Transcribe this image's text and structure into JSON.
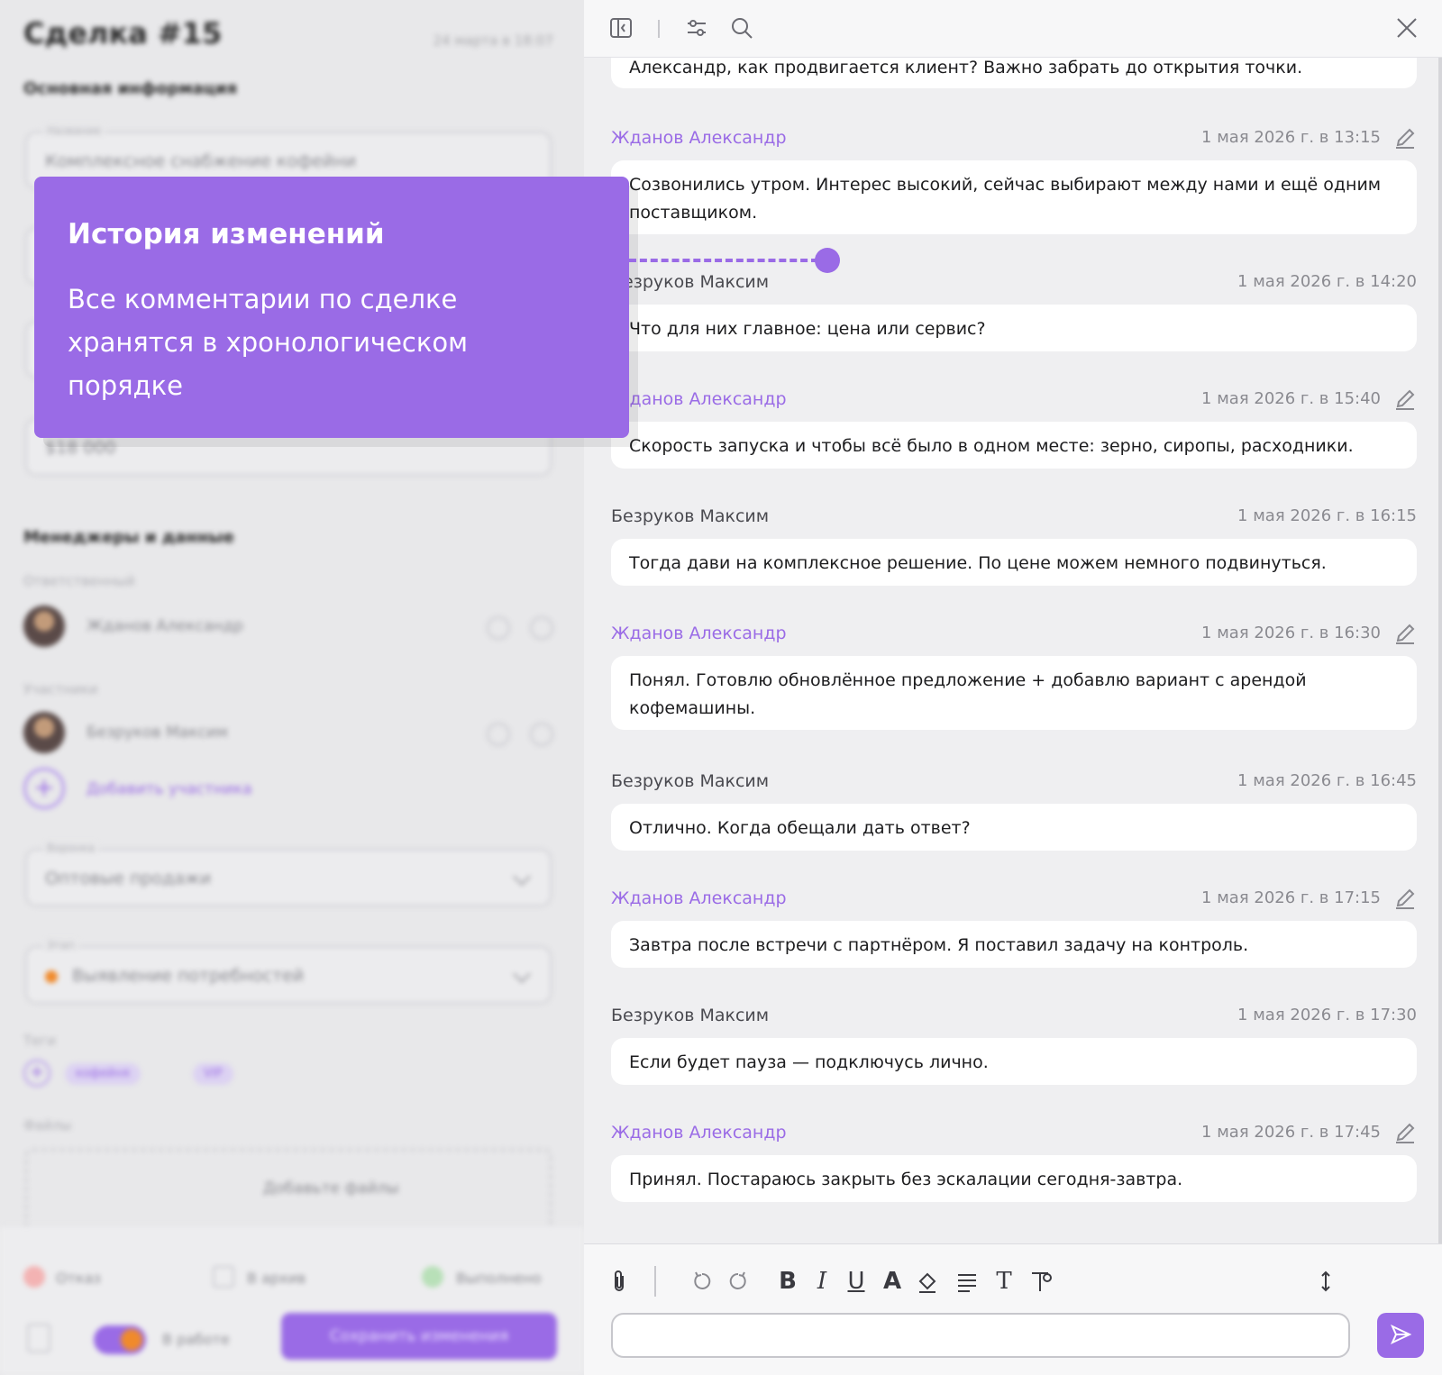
{
  "deal": {
    "title": "Сделка #15",
    "date": "24 марта в 18:07",
    "main_info_heading": "Основная информация",
    "name_label": "Название",
    "name_value": "Комплексное снабжение кофейни",
    "amount_value": "$18 000",
    "managers_heading": "Менеджеры и данные",
    "responsible_label": "Ответственный",
    "responsible_name": "Жданов Александр",
    "participants_label": "Участники",
    "participant_name": "Безруков Максим",
    "add_participant": "Добавить участника",
    "funnel_label": "Воронка",
    "funnel_value": "Оптовые продажи",
    "stage_label": "Этап",
    "stage_value": "Выявление потребностей",
    "tags_label": "Теги",
    "tags": [
      "кофейня",
      "VIP"
    ],
    "files_label": "Файлы",
    "add_files": "Добавьте файлы",
    "footer": {
      "reject": "Отказ",
      "archive": "В архив",
      "done": "Выполнено",
      "toggle_label": "В работе",
      "save_button": "Сохранить изменения"
    }
  },
  "callout": {
    "title": "История изменений",
    "body": "Все комментарии по сделке хранятся в хронологическом порядке"
  },
  "messages": [
    {
      "author": "",
      "date": "",
      "text": "Александр, как продвигается клиент? Важно забрать до открытия точки.",
      "editable": false
    },
    {
      "author": "Жданов Александр",
      "date": "1 мая 2026 г. в 13:15",
      "text": "Созвонились утром. Интерес высокий, сейчас выбирают между нами и ещё одним поставщиком.",
      "editable": true
    },
    {
      "author": "Безруков Максим",
      "date": "1 мая 2026 г. в 14:20",
      "text": "Что для них главное: цена или сервис?",
      "editable": false
    },
    {
      "author": "Жданов Александр",
      "date": "1 мая 2026 г. в 15:40",
      "text": "Скорость запуска и чтобы всё было в одном месте: зерно, сиропы, расходники.",
      "editable": true
    },
    {
      "author": "Безруков Максим",
      "date": "1 мая 2026 г. в 16:15",
      "text": "Тогда дави на комплексное решение. По цене можем немного подвинуться.",
      "editable": false
    },
    {
      "author": "Жданов Александр",
      "date": "1 мая 2026 г. в 16:30",
      "text": "Понял. Готовлю обновлённое предложение + добавлю вариант с арендой кофемашины.",
      "editable": true
    },
    {
      "author": "Безруков Максим",
      "date": "1 мая 2026 г. в 16:45",
      "text": "Отлично. Когда обещали дать ответ?",
      "editable": false
    },
    {
      "author": "Жданов Александр",
      "date": "1 мая 2026 г. в 17:15",
      "text": "Завтра после встречи с партнёром. Я поставил задачу на контроль.",
      "editable": true
    },
    {
      "author": "Безруков Максим",
      "date": "1 мая 2026 г. в 17:30",
      "text": "Если будет пауза — подключусь лично.",
      "editable": false
    },
    {
      "author": "Жданов Александр",
      "date": "1 мая 2026 г. в 17:45",
      "text": "Принял. Постараюсь закрыть без эскалации сегодня-завтра.",
      "editable": true
    }
  ],
  "composer": {
    "placeholder": "",
    "bold": "B",
    "italic": "I",
    "underline": "U",
    "font_color": "A",
    "text_style": "T"
  },
  "colors": {
    "accent": "#9a6be6",
    "panel_bg": "#efeff1"
  }
}
